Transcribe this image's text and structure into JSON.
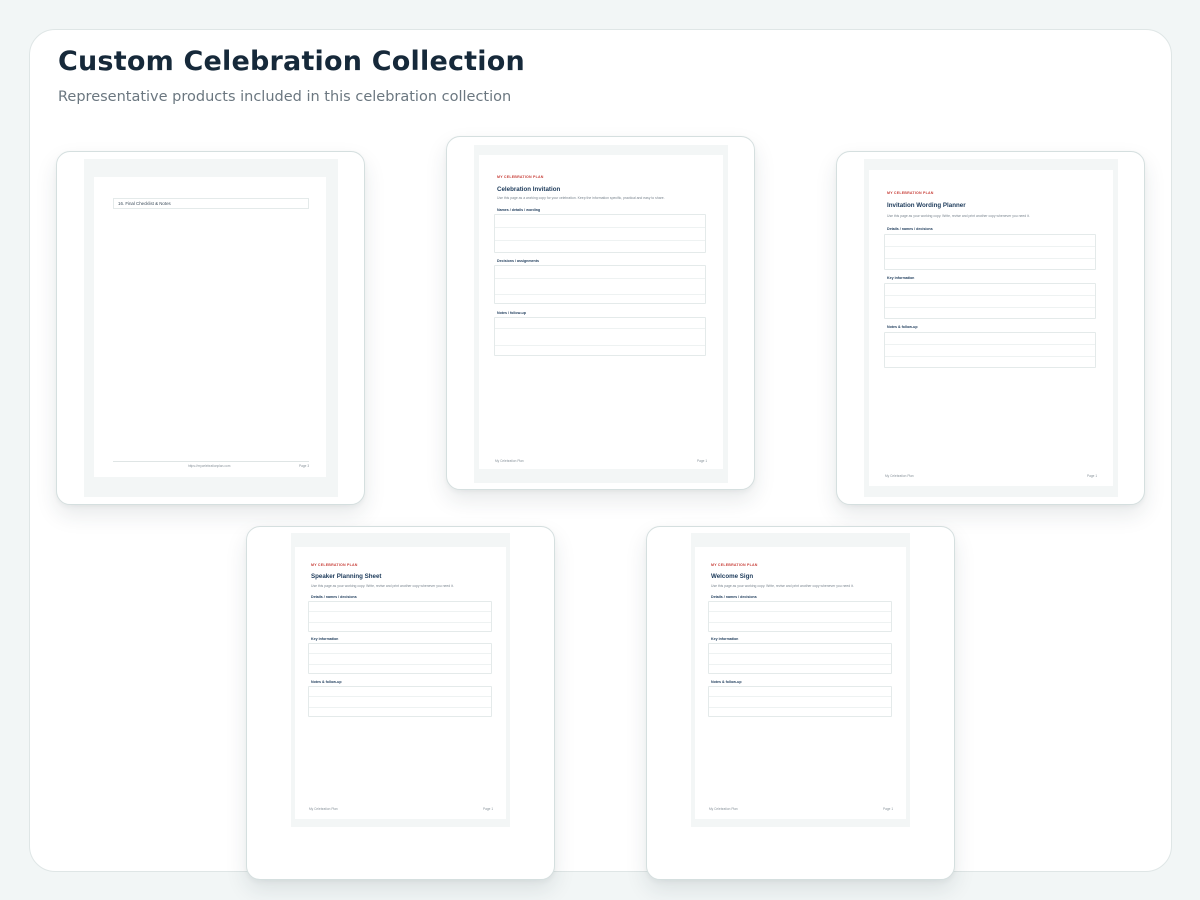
{
  "header": {
    "title": "Custom Celebration Collection",
    "subtitle": "Representative products included in this celebration collection"
  },
  "colors": {
    "accent_red": "#c8403a",
    "heading_navy": "#1c3a5a",
    "page_bg": "#f2f6f6"
  },
  "products": [
    {
      "section_row": "16. Final Checklist & Notes",
      "footer_center": "https://mycelebrationplan.com",
      "footer_right": "Page 3"
    },
    {
      "brand": "MY CELEBRATION PLAN",
      "title": "Celebration Invitation",
      "intro": "Use this page as a working copy for your celebration. Keep the information specific, practical and easy to share.",
      "sections": [
        "Names / details / wording",
        "Decisions / assignments",
        "Notes / follow-up"
      ],
      "footer_left": "My Celebration Plan",
      "footer_right": "Page 1"
    },
    {
      "brand": "MY CELEBRATION PLAN",
      "title": "Invitation Wording Planner",
      "intro": "Use this page as your working copy. Write, revise and print another copy whenever you need it.",
      "sections": [
        "Details / names / decisions",
        "Key information",
        "Notes & follow-up"
      ],
      "footer_left": "My Celebration Plan",
      "footer_right": "Page 1"
    },
    {
      "brand": "MY CELEBRATION PLAN",
      "title": "Speaker Planning Sheet",
      "intro": "Use this page as your working copy. Write, revise and print another copy whenever you need it.",
      "sections": [
        "Details / names / decisions",
        "Key information",
        "Notes & follow-up"
      ],
      "footer_left": "My Celebration Plan",
      "footer_right": "Page 1"
    },
    {
      "brand": "MY CELEBRATION PLAN",
      "title": "Welcome Sign",
      "intro": "Use this page as your working copy. Write, revise and print another copy whenever you need it.",
      "sections": [
        "Details / names / decisions",
        "Key information",
        "Notes & follow-up"
      ],
      "footer_left": "My Celebration Plan",
      "footer_right": "Page 1"
    }
  ]
}
